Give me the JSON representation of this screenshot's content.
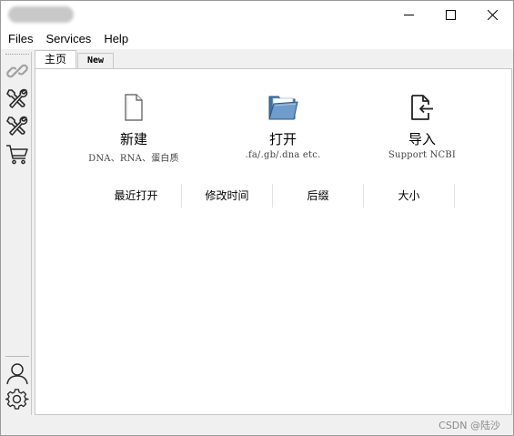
{
  "menu": {
    "files": "Files",
    "services": "Services",
    "help": "Help"
  },
  "tabs": [
    {
      "label": "主页",
      "active": true
    },
    {
      "label": "New",
      "active": false
    }
  ],
  "left_toolbar": {
    "icons": [
      "link-icon",
      "tools-icon",
      "tools-icon",
      "cart-icon",
      "user-icon",
      "gear-icon"
    ]
  },
  "actions": {
    "new": {
      "title": "新建",
      "subtitle": "DNA、RNA、蛋白质",
      "icon": "file-icon"
    },
    "open": {
      "title": "打开",
      "subtitle": ".fa/.gb/.dna etc.",
      "icon": "folder-open-icon"
    },
    "import": {
      "title": "导入",
      "subtitle": "Support NCBI",
      "icon": "file-import-icon"
    }
  },
  "columns": [
    "最近打开",
    "修改时间",
    "后缀",
    "大小"
  ],
  "watermark": "CSDN @陆沙",
  "colors": {
    "folder": "#4a7fb5",
    "window_bg": "#f0f0f0",
    "content_bg": "#ffffff"
  }
}
